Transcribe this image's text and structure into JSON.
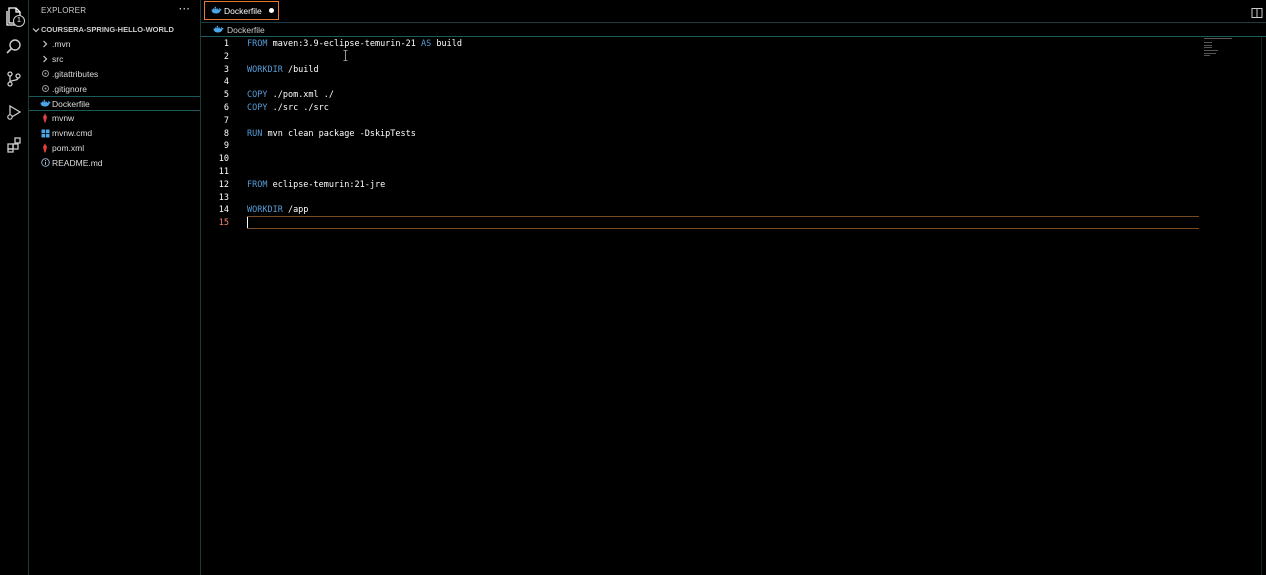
{
  "explorer": {
    "title": "EXPLORER",
    "more_label": "···",
    "folder_name": "COURSERA-SPRING-HELLO-WORLD",
    "items": [
      {
        "label": ".mvn",
        "icon": "chevron-right-icon"
      },
      {
        "label": "src",
        "icon": "chevron-right-icon"
      },
      {
        "label": ".gitattributes",
        "icon": "git-icon"
      },
      {
        "label": ".gitignore",
        "icon": "git-icon"
      },
      {
        "label": "Dockerfile",
        "icon": "docker-icon"
      },
      {
        "label": "mvnw",
        "icon": "maven-icon"
      },
      {
        "label": "mvnw.cmd",
        "icon": "windows-icon"
      },
      {
        "label": "pom.xml",
        "icon": "maven-icon"
      },
      {
        "label": "README.md",
        "icon": "info-icon"
      }
    ]
  },
  "activity_bar": {
    "explorer_badge": "1",
    "icons": [
      "files-icon",
      "search-icon",
      "source-control-icon",
      "run-debug-icon",
      "extensions-icon"
    ]
  },
  "tab": {
    "label": "Dockerfile",
    "modified": true
  },
  "breadcrumb": {
    "label": "Dockerfile"
  },
  "editor": {
    "active_line": 15,
    "lines": [
      {
        "n": "1",
        "kw": "FROM",
        "rest": " maven:3.9-eclipse-temurin-21 ",
        "kw2": "AS",
        "rest2": " build"
      },
      {
        "n": "2",
        "kw": "",
        "rest": ""
      },
      {
        "n": "3",
        "kw": "WORKDIR",
        "rest": " /build"
      },
      {
        "n": "4",
        "kw": "",
        "rest": ""
      },
      {
        "n": "5",
        "kw": "COPY",
        "rest": " ./pom.xml ./"
      },
      {
        "n": "6",
        "kw": "COPY",
        "rest": " ./src ./src"
      },
      {
        "n": "7",
        "kw": "",
        "rest": ""
      },
      {
        "n": "8",
        "kw": "RUN",
        "rest": " mvn clean package -DskipTests"
      },
      {
        "n": "9",
        "kw": "",
        "rest": ""
      },
      {
        "n": "10",
        "kw": "",
        "rest": ""
      },
      {
        "n": "11",
        "kw": "",
        "rest": ""
      },
      {
        "n": "12",
        "kw": "FROM",
        "rest": " eclipse-temurin:21-jre"
      },
      {
        "n": "13",
        "kw": "",
        "rest": ""
      },
      {
        "n": "14",
        "kw": "WORKDIR",
        "rest": " /app"
      },
      {
        "n": "15",
        "kw": "",
        "rest": ""
      }
    ]
  },
  "colors": {
    "keyword": "#569cd6",
    "text": "#ffffff",
    "active_line_number": "#f48771",
    "tab_border": "#e37933",
    "docker_blue": "#4aa8e8",
    "maven_red": "#e2403f"
  }
}
